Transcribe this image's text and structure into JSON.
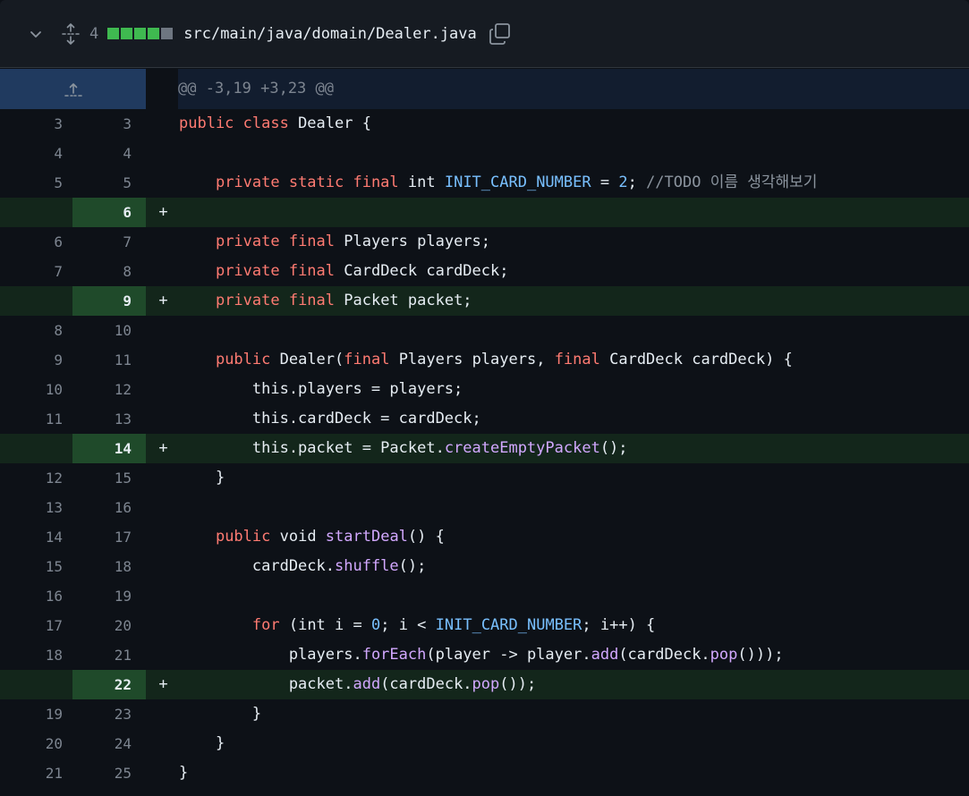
{
  "file_header": {
    "changes_count": "4",
    "diffstat": [
      "added",
      "added",
      "added",
      "added",
      "neutral"
    ],
    "path": "src/main/java/domain/Dealer.java",
    "icons": {
      "collapse": "chevron-down-icon",
      "expand": "unfold-icon",
      "copy": "copy-icon"
    }
  },
  "hunk": {
    "header": "@@ -3,19 +3,23 @@",
    "expand_icon": "expand-up-icon"
  },
  "colors": {
    "added_bg": "#13261b",
    "added_num_bg": "#1f4a2a",
    "hunk_gutter_bg": "#203a5f",
    "keyword": "#ff7b72",
    "constant": "#79c0ff",
    "function": "#d2a8ff",
    "comment": "#8b949e"
  },
  "lines": [
    {
      "old": "3",
      "new": "3",
      "type": "ctx",
      "sign": "",
      "tokens": [
        [
          "kw",
          "public class "
        ],
        [
          "",
          "Dealer {"
        ]
      ]
    },
    {
      "old": "4",
      "new": "4",
      "type": "ctx",
      "sign": "",
      "tokens": []
    },
    {
      "old": "5",
      "new": "5",
      "type": "ctx",
      "sign": "",
      "tokens": [
        [
          "",
          "    "
        ],
        [
          "kw",
          "private static final "
        ],
        [
          "",
          "int "
        ],
        [
          "const",
          "INIT_CARD_NUMBER"
        ],
        [
          "",
          " = "
        ],
        [
          "const",
          "2"
        ],
        [
          "",
          "; "
        ],
        [
          "cmt",
          "//TODO 이름 생각해보기"
        ]
      ]
    },
    {
      "old": "",
      "new": "6",
      "type": "add",
      "sign": "+",
      "tokens": []
    },
    {
      "old": "6",
      "new": "7",
      "type": "ctx",
      "sign": "",
      "tokens": [
        [
          "",
          "    "
        ],
        [
          "kw",
          "private final "
        ],
        [
          "",
          "Players players;"
        ]
      ]
    },
    {
      "old": "7",
      "new": "8",
      "type": "ctx",
      "sign": "",
      "tokens": [
        [
          "",
          "    "
        ],
        [
          "kw",
          "private final "
        ],
        [
          "",
          "CardDeck cardDeck;"
        ]
      ]
    },
    {
      "old": "",
      "new": "9",
      "type": "add",
      "sign": "+",
      "tokens": [
        [
          "",
          "    "
        ],
        [
          "kw",
          "private final "
        ],
        [
          "",
          "Packet packet;"
        ]
      ]
    },
    {
      "old": "8",
      "new": "10",
      "type": "ctx",
      "sign": "",
      "tokens": []
    },
    {
      "old": "9",
      "new": "11",
      "type": "ctx",
      "sign": "",
      "tokens": [
        [
          "",
          "    "
        ],
        [
          "kw",
          "public "
        ],
        [
          "",
          "Dealer("
        ],
        [
          "kw",
          "final "
        ],
        [
          "",
          "Players players, "
        ],
        [
          "kw",
          "final "
        ],
        [
          "",
          "CardDeck cardDeck) {"
        ]
      ]
    },
    {
      "old": "10",
      "new": "12",
      "type": "ctx",
      "sign": "",
      "tokens": [
        [
          "",
          "        this.players = players;"
        ]
      ]
    },
    {
      "old": "11",
      "new": "13",
      "type": "ctx",
      "sign": "",
      "tokens": [
        [
          "",
          "        this.cardDeck = cardDeck;"
        ]
      ]
    },
    {
      "old": "",
      "new": "14",
      "type": "add",
      "sign": "+",
      "tokens": [
        [
          "",
          "        this.packet = Packet."
        ],
        [
          "fn",
          "createEmptyPacket"
        ],
        [
          "",
          "();"
        ]
      ]
    },
    {
      "old": "12",
      "new": "15",
      "type": "ctx",
      "sign": "",
      "tokens": [
        [
          "",
          "    }"
        ]
      ]
    },
    {
      "old": "13",
      "new": "16",
      "type": "ctx",
      "sign": "",
      "tokens": []
    },
    {
      "old": "14",
      "new": "17",
      "type": "ctx",
      "sign": "",
      "tokens": [
        [
          "",
          "    "
        ],
        [
          "kw",
          "public "
        ],
        [
          "",
          "void "
        ],
        [
          "fn",
          "startDeal"
        ],
        [
          "",
          "() {"
        ]
      ]
    },
    {
      "old": "15",
      "new": "18",
      "type": "ctx",
      "sign": "",
      "tokens": [
        [
          "",
          "        cardDeck."
        ],
        [
          "fn",
          "shuffle"
        ],
        [
          "",
          "();"
        ]
      ]
    },
    {
      "old": "16",
      "new": "19",
      "type": "ctx",
      "sign": "",
      "tokens": []
    },
    {
      "old": "17",
      "new": "20",
      "type": "ctx",
      "sign": "",
      "tokens": [
        [
          "",
          "        "
        ],
        [
          "kw",
          "for "
        ],
        [
          "",
          "(int i = "
        ],
        [
          "const",
          "0"
        ],
        [
          "",
          "; i < "
        ],
        [
          "const",
          "INIT_CARD_NUMBER"
        ],
        [
          "",
          "; i++) {"
        ]
      ]
    },
    {
      "old": "18",
      "new": "21",
      "type": "ctx",
      "sign": "",
      "tokens": [
        [
          "",
          "            players."
        ],
        [
          "fn",
          "forEach"
        ],
        [
          "",
          "(player -> player."
        ],
        [
          "fn",
          "add"
        ],
        [
          "",
          "(cardDeck."
        ],
        [
          "fn",
          "pop"
        ],
        [
          "",
          "()));"
        ]
      ]
    },
    {
      "old": "",
      "new": "22",
      "type": "add",
      "sign": "+",
      "tokens": [
        [
          "",
          "            packet."
        ],
        [
          "fn",
          "add"
        ],
        [
          "",
          "(cardDeck."
        ],
        [
          "fn",
          "pop"
        ],
        [
          "",
          "());"
        ]
      ]
    },
    {
      "old": "19",
      "new": "23",
      "type": "ctx",
      "sign": "",
      "tokens": [
        [
          "",
          "        }"
        ]
      ]
    },
    {
      "old": "20",
      "new": "24",
      "type": "ctx",
      "sign": "",
      "tokens": [
        [
          "",
          "    }"
        ]
      ]
    },
    {
      "old": "21",
      "new": "25",
      "type": "ctx",
      "sign": "",
      "tokens": [
        [
          "",
          "}"
        ]
      ]
    }
  ]
}
